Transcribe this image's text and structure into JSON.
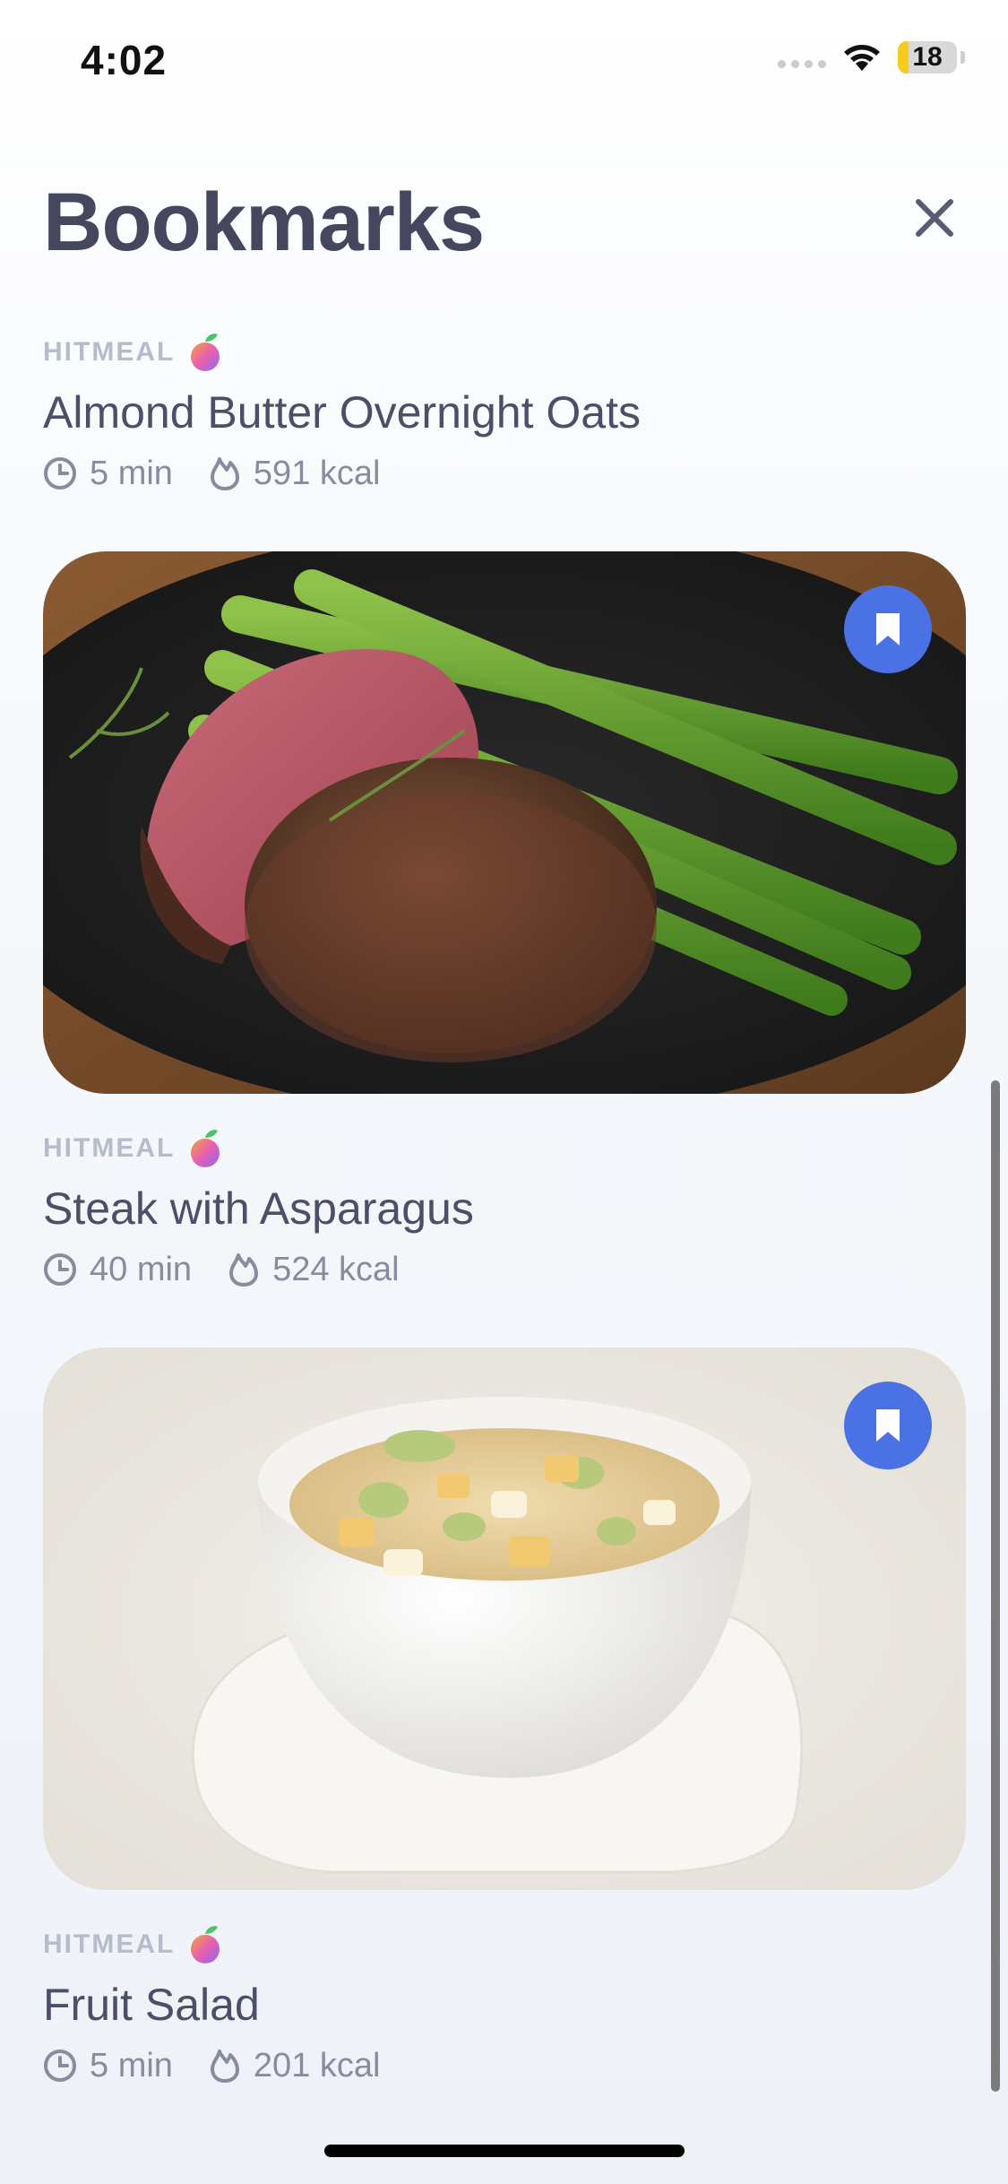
{
  "status_bar": {
    "time": "4:02",
    "battery": "18",
    "battery_level": 0.18
  },
  "header": {
    "title": "Bookmarks"
  },
  "recipes": [
    {
      "source": "HITMEAL",
      "title": "Almond Butter Overnight Oats",
      "time": "5 min",
      "calories": "591 kcal",
      "bookmarked": true
    },
    {
      "source": "HITMEAL",
      "title": "Steak with Asparagus",
      "time": "40 min",
      "calories": "524 kcal",
      "bookmarked": true
    },
    {
      "source": "HITMEAL",
      "title": "Fruit Salad",
      "time": "5 min",
      "calories": "201 kcal",
      "bookmarked": true
    }
  ],
  "colors": {
    "accent": "#4a72e5",
    "title": "#45475e",
    "muted": "#878c9e"
  },
  "icons": {
    "close": "close-icon",
    "bookmark": "bookmark-icon",
    "clock": "clock-icon",
    "flame": "flame-icon",
    "brand": "peach-logo-icon"
  }
}
